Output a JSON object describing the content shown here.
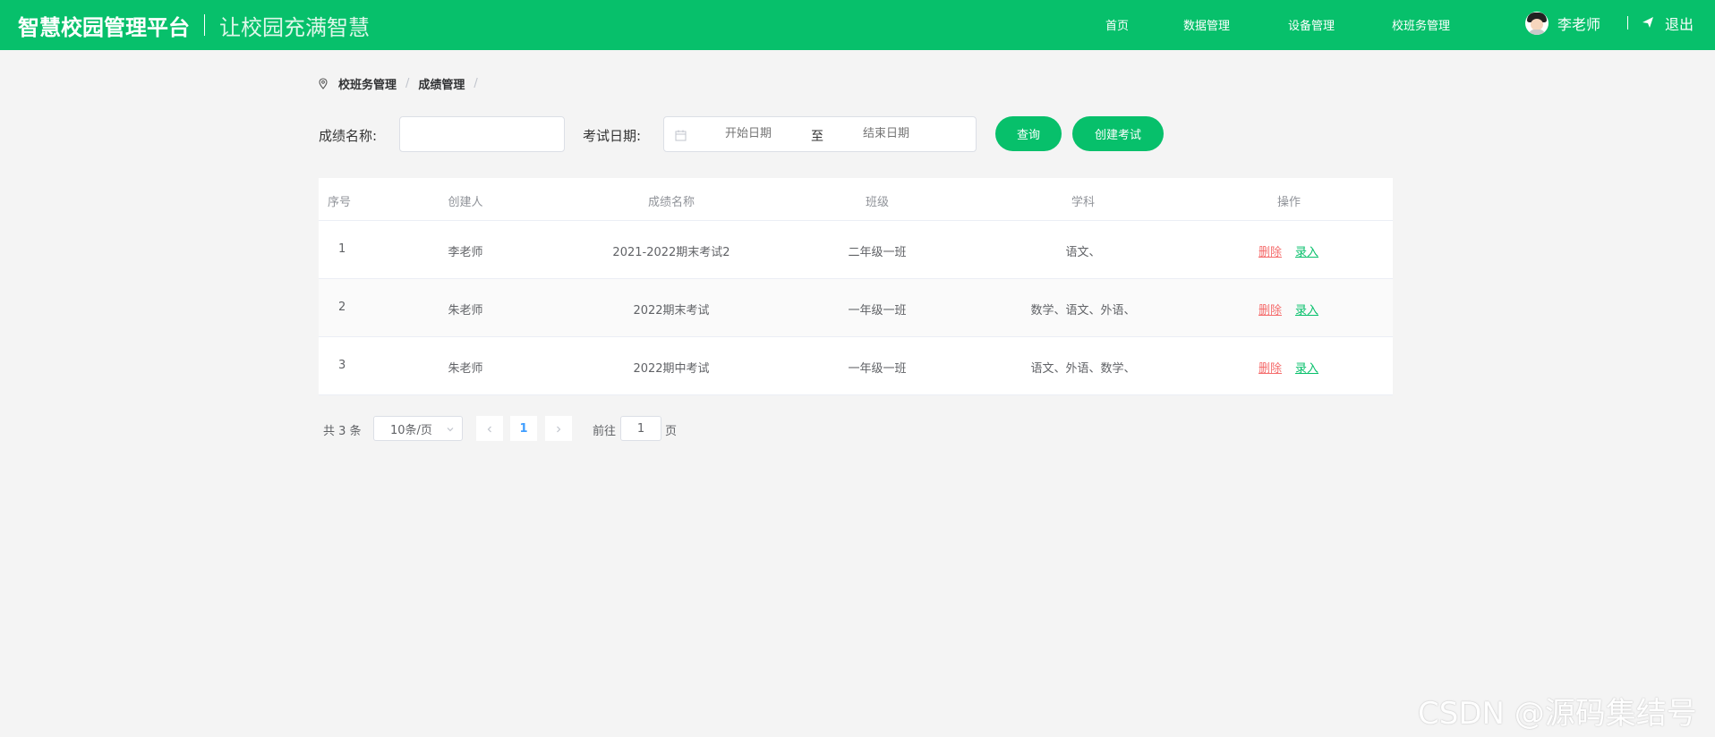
{
  "header": {
    "title": "智慧校园管理平台",
    "slogan": "让校园充满智慧",
    "nav": [
      "首页",
      "数据管理",
      "设备管理",
      "校班务管理"
    ],
    "user_name": "李老师",
    "logout": "退出",
    "colors": {
      "primary": "#07c06b"
    }
  },
  "breadcrumb": [
    "校班务管理",
    "成绩管理"
  ],
  "filters": {
    "name_label": "成绩名称:",
    "name_value": "",
    "date_label": "考试日期:",
    "date_start_placeholder": "开始日期",
    "date_to": "至",
    "date_end_placeholder": "结束日期",
    "query_button": "查询",
    "create_button": "创建考试"
  },
  "table": {
    "headers": [
      "序号",
      "创建人",
      "成绩名称",
      "班级",
      "学科",
      "操作"
    ],
    "rows": [
      {
        "index": "1",
        "creator": "李老师",
        "name": "2021-2022期末考试2",
        "class": "二年级一班",
        "subjects": "语文、",
        "delete": "删除",
        "entry": "录入"
      },
      {
        "index": "2",
        "creator": "朱老师",
        "name": "2022期末考试",
        "class": "一年级一班",
        "subjects": "数学、语文、外语、",
        "delete": "删除",
        "entry": "录入"
      },
      {
        "index": "3",
        "creator": "朱老师",
        "name": "2022期中考试",
        "class": "一年级一班",
        "subjects": "语文、外语、数学、",
        "delete": "删除",
        "entry": "录入"
      }
    ]
  },
  "pagination": {
    "total": "共 3 条",
    "page_size": "10条/页",
    "current_page": "1",
    "goto_label": "前往",
    "goto_value": "1",
    "page_suffix": "页"
  },
  "watermark": "CSDN @源码集结号"
}
